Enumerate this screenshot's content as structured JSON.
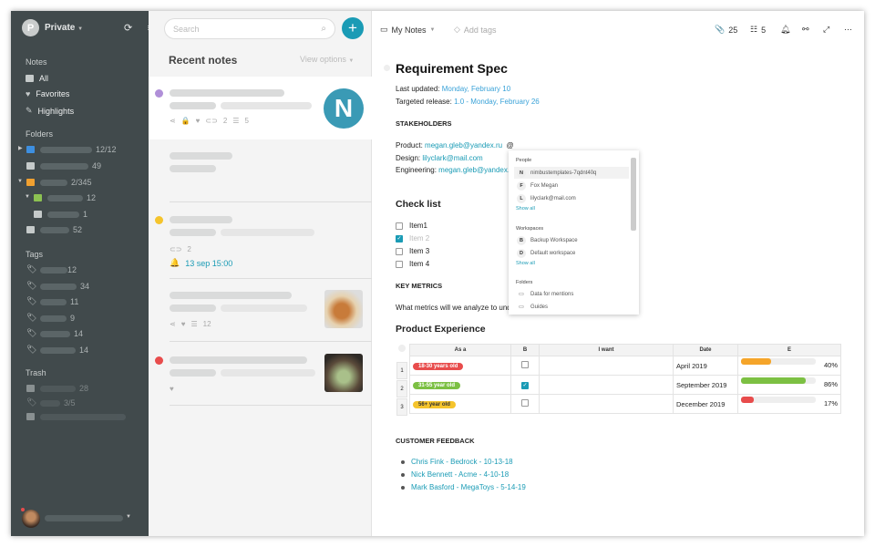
{
  "sidebar": {
    "workspace": "Private",
    "avatar_letter": "P",
    "notes_title": "Notes",
    "items": [
      {
        "label": "All"
      },
      {
        "label": "Favorites"
      },
      {
        "label": "Highlights"
      }
    ],
    "folders_title": "Folders",
    "folders": [
      "12/12",
      "49",
      "2/345",
      "12",
      "1",
      "52"
    ],
    "tags_title": "Tags",
    "tags": [
      "12",
      "34",
      "11",
      "9",
      "14",
      "14"
    ],
    "trash_title": "Trash",
    "trash": [
      "28",
      "3/5"
    ]
  },
  "list": {
    "search_placeholder": "Search",
    "title": "Recent notes",
    "view_options": "View options",
    "note1": {
      "attachments": "2",
      "todos": "5",
      "avatar": "N",
      "color": "#b08fd8"
    },
    "note3": {
      "attachments": "2",
      "reminder": "13 sep 15:00",
      "color": "#f5c42c"
    },
    "note4": {
      "todos": "12"
    },
    "note5": {
      "color": "#e84c4c"
    }
  },
  "toolbar": {
    "folder": "My Notes",
    "add_tags": "Add tags",
    "attachments": "25",
    "todos": "5"
  },
  "doc": {
    "title": "Requirement Spec",
    "last_updated_label": "Last updated:",
    "last_updated": "Monday, February 10",
    "release_label": "Targeted release:",
    "release": "1.0 - Monday, February 26",
    "stakeholders": "STAKEHOLDERS",
    "product_label": "Product:",
    "product": "megan.gleb@yandex.ru",
    "mention": "@",
    "design_label": "Design:",
    "design": "lilyclark@mail.com",
    "eng_label": "Engineering:",
    "eng": "megan.gleb@yandex.ru",
    "checklist_title": "Check list",
    "checklist": [
      {
        "label": "Item1",
        "checked": false
      },
      {
        "label": "Item 2",
        "checked": true
      },
      {
        "label": "Item 3",
        "checked": false
      },
      {
        "label": "Item 4",
        "checked": false
      }
    ],
    "key_metrics": "KEY METRICS",
    "metrics_text": "What metrics will we analyze to und",
    "product_exp": "Product Experience",
    "table": {
      "headers": [
        "As a",
        "B",
        "I want",
        "Date",
        "E"
      ],
      "rows": [
        {
          "n": "1",
          "as": "18-30 years old",
          "color": "#e84c4c",
          "b": false,
          "date": "April 2019",
          "pct": 40,
          "pct_label": "40%",
          "bar": "#f5a52a"
        },
        {
          "n": "2",
          "as": "31-55 year old",
          "color": "#7cc043",
          "b": true,
          "date": "September 2019",
          "pct": 86,
          "pct_label": "86%",
          "bar": "#7cc043"
        },
        {
          "n": "3",
          "as": "56+ year old",
          "color": "#f5c42c",
          "b": false,
          "date": "December 2019",
          "pct": 17,
          "pct_label": "17%",
          "bar": "#e84c4c"
        }
      ]
    },
    "feedback_title": "CUSTOMER FEEDBACK",
    "feedback": [
      "Chris Fink - Bedrock - 10-13-18",
      "Nick Bennett  - Acme - 4-10-18",
      "Mark Basford - MegaToys - 5-14-19"
    ]
  },
  "mention_dropdown": {
    "people_title": "People",
    "people": [
      {
        "l": "N",
        "name": "nimbustemplates-7qdnt40q"
      },
      {
        "l": "F",
        "name": "Fox Megan"
      },
      {
        "l": "L",
        "name": "lilyclark@mail.com"
      }
    ],
    "show_all": "Show all",
    "workspaces_title": "Workspaces",
    "workspaces": [
      {
        "l": "B",
        "name": "Backup Workspace"
      },
      {
        "l": "D",
        "name": "Default workspace"
      }
    ],
    "folders_title": "Folders",
    "folders": [
      "Data for mentions",
      "Guides"
    ]
  }
}
